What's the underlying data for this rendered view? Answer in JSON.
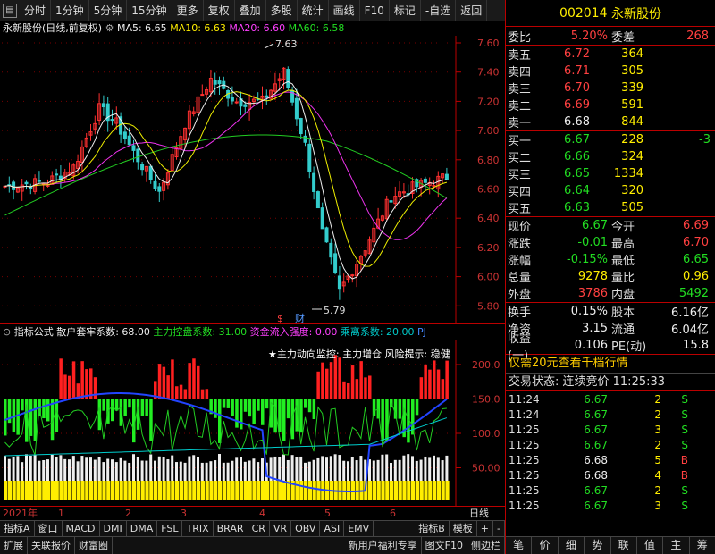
{
  "toolbar": {
    "items": [
      "分时",
      "1分钟",
      "5分钟",
      "15分钟",
      "更多",
      "复权",
      "叠加",
      "多股",
      "统计",
      "画线",
      "F10",
      "标记",
      "-自选",
      "返回"
    ]
  },
  "chart_head": {
    "name": "永新股份(日线,前复权)",
    "ma5": "MA5: 6.65",
    "ma10": "MA10: 6.63",
    "ma20": "MA20: 6.60",
    "ma60": "MA60: 6.58"
  },
  "price_axis": [
    "7.60",
    "7.40",
    "7.20",
    "7.00",
    "6.80",
    "6.60",
    "6.40",
    "6.20",
    "6.00",
    "5.80"
  ],
  "annotations": {
    "high": "7.63",
    "low": "5.79",
    "cai": "财",
    "dollar": "$"
  },
  "indicator_head": {
    "label": "指标公式",
    "s1": "散户套牢系数: 68.00",
    "s2": "主力控盘系数: 31.00",
    "s3": "资金流入强度: 0.00",
    "s4": "乘离系数: 20.00",
    "s5": "PJ",
    "monitor": "★主力动向监控: 主力增仓 风险提示: 稳健"
  },
  "sub_axis": [
    "200.0",
    "150.0",
    "100.0",
    "50.00"
  ],
  "date_axis": {
    "year": "2021年",
    "months": [
      "1",
      "2",
      "3",
      "4",
      "5",
      "6"
    ],
    "right": "日线"
  },
  "tabs1": [
    "指标A",
    "窗口",
    "MACD",
    "DMI",
    "DMA",
    "FSL",
    "TRIX",
    "BRAR",
    "CR",
    "VR",
    "OBV",
    "ASI",
    "EMV",
    "指标B",
    "模板",
    "+",
    "-"
  ],
  "tabs2": [
    "扩展",
    "关联报价",
    "财富圈",
    "新用户福利专享",
    "图文F10",
    "侧边栏"
  ],
  "stock": {
    "code": "002014",
    "name": "永新股份"
  },
  "webi": {
    "l1": "委比",
    "v1": "5.20%",
    "l2": "委差",
    "v2": "268"
  },
  "asks": [
    {
      "l": "卖五",
      "p": "6.72",
      "v": "364"
    },
    {
      "l": "卖四",
      "p": "6.71",
      "v": "305"
    },
    {
      "l": "卖三",
      "p": "6.70",
      "v": "339"
    },
    {
      "l": "卖二",
      "p": "6.69",
      "v": "591"
    },
    {
      "l": "卖一",
      "p": "6.68",
      "v": "844"
    }
  ],
  "bids": [
    {
      "l": "买一",
      "p": "6.67",
      "v": "228",
      "x": "-3"
    },
    {
      "l": "买二",
      "p": "6.66",
      "v": "324",
      "x": ""
    },
    {
      "l": "买三",
      "p": "6.65",
      "v": "1334",
      "x": ""
    },
    {
      "l": "买四",
      "p": "6.64",
      "v": "320",
      "x": ""
    },
    {
      "l": "买五",
      "p": "6.63",
      "v": "505",
      "x": ""
    }
  ],
  "info": [
    {
      "a": "现价",
      "b": "6.67",
      "c": "今开",
      "d": "6.69"
    },
    {
      "a": "涨跌",
      "b": "-0.01",
      "c": "最高",
      "d": "6.70"
    },
    {
      "a": "涨幅",
      "b": "-0.15%",
      "c": "最低",
      "d": "6.65"
    },
    {
      "a": "总量",
      "b": "9278",
      "c": "量比",
      "d": "0.96"
    },
    {
      "a": "外盘",
      "b": "3786",
      "c": "内盘",
      "d": "5492"
    }
  ],
  "info2": [
    {
      "a": "换手",
      "b": "0.15%",
      "c": "股本",
      "d": "6.16亿"
    },
    {
      "a": "净资",
      "b": "3.15",
      "c": "流通",
      "d": "6.04亿"
    },
    {
      "a": "收益(一)",
      "b": "0.106",
      "c": "PE(动)",
      "d": "15.8"
    }
  ],
  "promo": "仅需20元查看千档行情",
  "trade_state": "交易状态: 连续竞价 11:25:33",
  "ticks": [
    {
      "t": "11:24",
      "p": "6.67",
      "v": "2",
      "s": "S"
    },
    {
      "t": "11:24",
      "p": "6.67",
      "v": "2",
      "s": "S"
    },
    {
      "t": "11:25",
      "p": "6.67",
      "v": "3",
      "s": "S"
    },
    {
      "t": "11:25",
      "p": "6.67",
      "v": "2",
      "s": "S"
    },
    {
      "t": "11:25",
      "p": "6.68",
      "v": "5",
      "s": "B"
    },
    {
      "t": "11:25",
      "p": "6.68",
      "v": "4",
      "s": "B"
    },
    {
      "t": "11:25",
      "p": "6.67",
      "v": "2",
      "s": "S"
    },
    {
      "t": "11:25",
      "p": "6.67",
      "v": "3",
      "s": "S"
    }
  ],
  "right_tabs": [
    "笔",
    "价",
    "细",
    "势",
    "联",
    "值",
    "主",
    "筹"
  ]
}
